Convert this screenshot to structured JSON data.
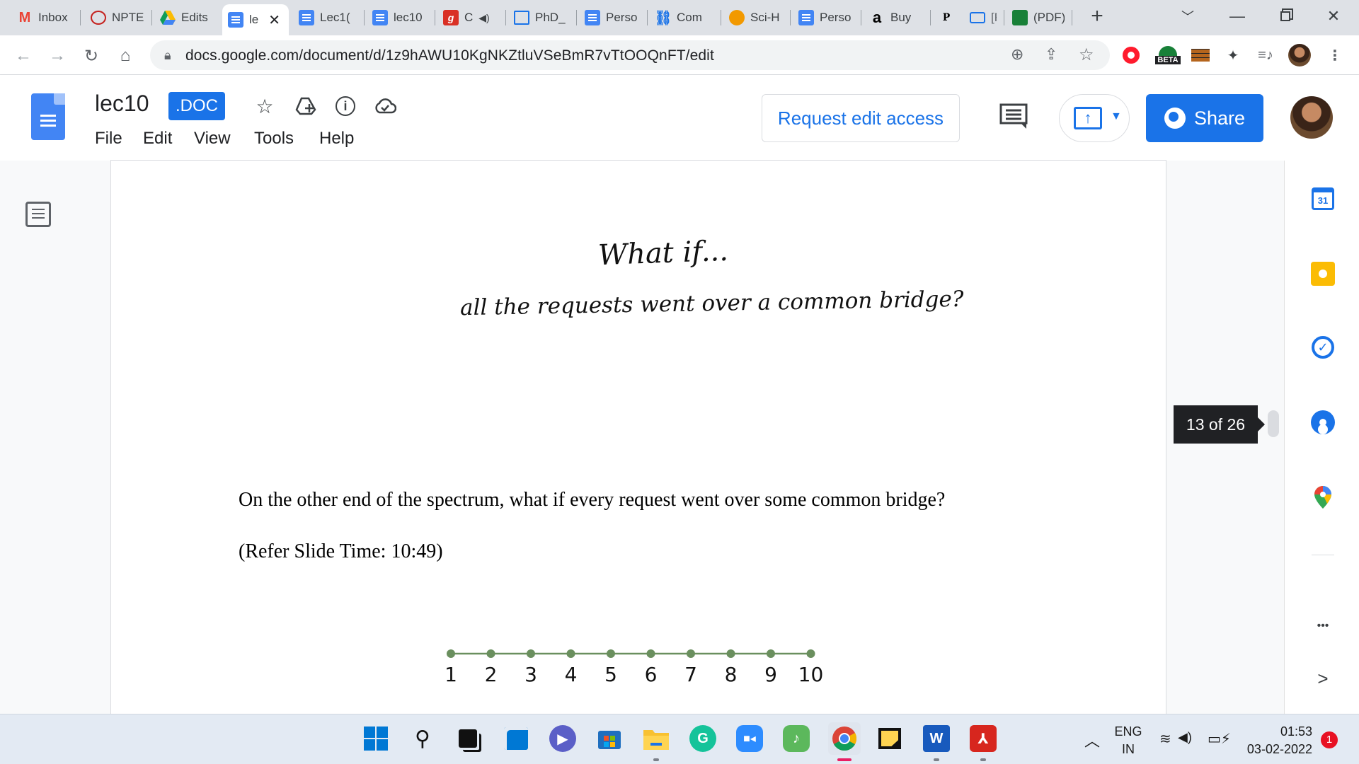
{
  "browser": {
    "tabs": [
      {
        "label": "Inbox",
        "icon": "gmail-icon",
        "color": "#ea4335"
      },
      {
        "label": "NPTE",
        "icon": "nptel-icon",
        "color": "#c5221f"
      },
      {
        "label": "Edits",
        "icon": "google-drive-icon",
        "color": "#fbbc04"
      },
      {
        "label": "le",
        "icon": "google-docs-icon",
        "color": "#4285f4",
        "active": true
      },
      {
        "label": "Lec1(",
        "icon": "google-docs-icon",
        "color": "#4285f4"
      },
      {
        "label": "lec10",
        "icon": "google-docs-icon",
        "color": "#4285f4"
      },
      {
        "label": "C",
        "icon": "g-letter-icon",
        "color": "#d93025"
      },
      {
        "label": "PhD_",
        "icon": "file-icon",
        "color": "#1a73e8"
      },
      {
        "label": "Perso",
        "icon": "google-docs-icon",
        "color": "#4285f4"
      },
      {
        "label": "Com",
        "icon": "link-icon",
        "color": "#1a73e8"
      },
      {
        "label": "Sci-H",
        "icon": "scihub-icon",
        "color": "#e37400"
      },
      {
        "label": "Perso",
        "icon": "google-docs-icon",
        "color": "#4285f4"
      },
      {
        "label": "Buy",
        "icon": "amazon-icon",
        "color": "#000000"
      },
      {
        "label": "P",
        "icon": "p-letter-icon",
        "color": "#000000"
      },
      {
        "label": "[F",
        "icon": "book-icon",
        "color": "#1a73e8"
      },
      {
        "label": "(PDF)",
        "icon": "pdf-site-icon",
        "color": "#188038"
      }
    ],
    "new_tab_label": "+",
    "url": "docs.google.com/document/d/1z9hAWU10KgNKZtluVSeBmR7vTtOOQnFT/edit",
    "beta_label": "BETA"
  },
  "doc": {
    "title": "lec10",
    "badge": ".DOC",
    "menu": [
      "File",
      "Edit",
      "View",
      "Tools",
      "Help"
    ],
    "request_edit_label": "Request edit access",
    "share_label": "Share",
    "slide_title_line1": "What if...",
    "slide_title_line2": "all the requests went over a common bridge?",
    "paragraph": "On the other end of the spectrum, what if every request went over some common bridge?",
    "refer_slide": "(Refer Slide Time: 10:49)",
    "number_line": [
      "1",
      "2",
      "3",
      "4",
      "5",
      "6",
      "7",
      "8",
      "9",
      "10"
    ],
    "number_line_color": "#6a8f5e",
    "page_indicator": "13 of 26"
  },
  "side_panel": {
    "calendar_day": "31",
    "more_label": "•••",
    "expand_label": ">"
  },
  "taskbar": {
    "lang_line1": "ENG",
    "lang_line2": "IN",
    "time": "01:53",
    "date": "03-02-2022",
    "notification_count": "1"
  },
  "colors": {
    "accent": "#1a73e8",
    "docs_blue": "#4285f4"
  }
}
